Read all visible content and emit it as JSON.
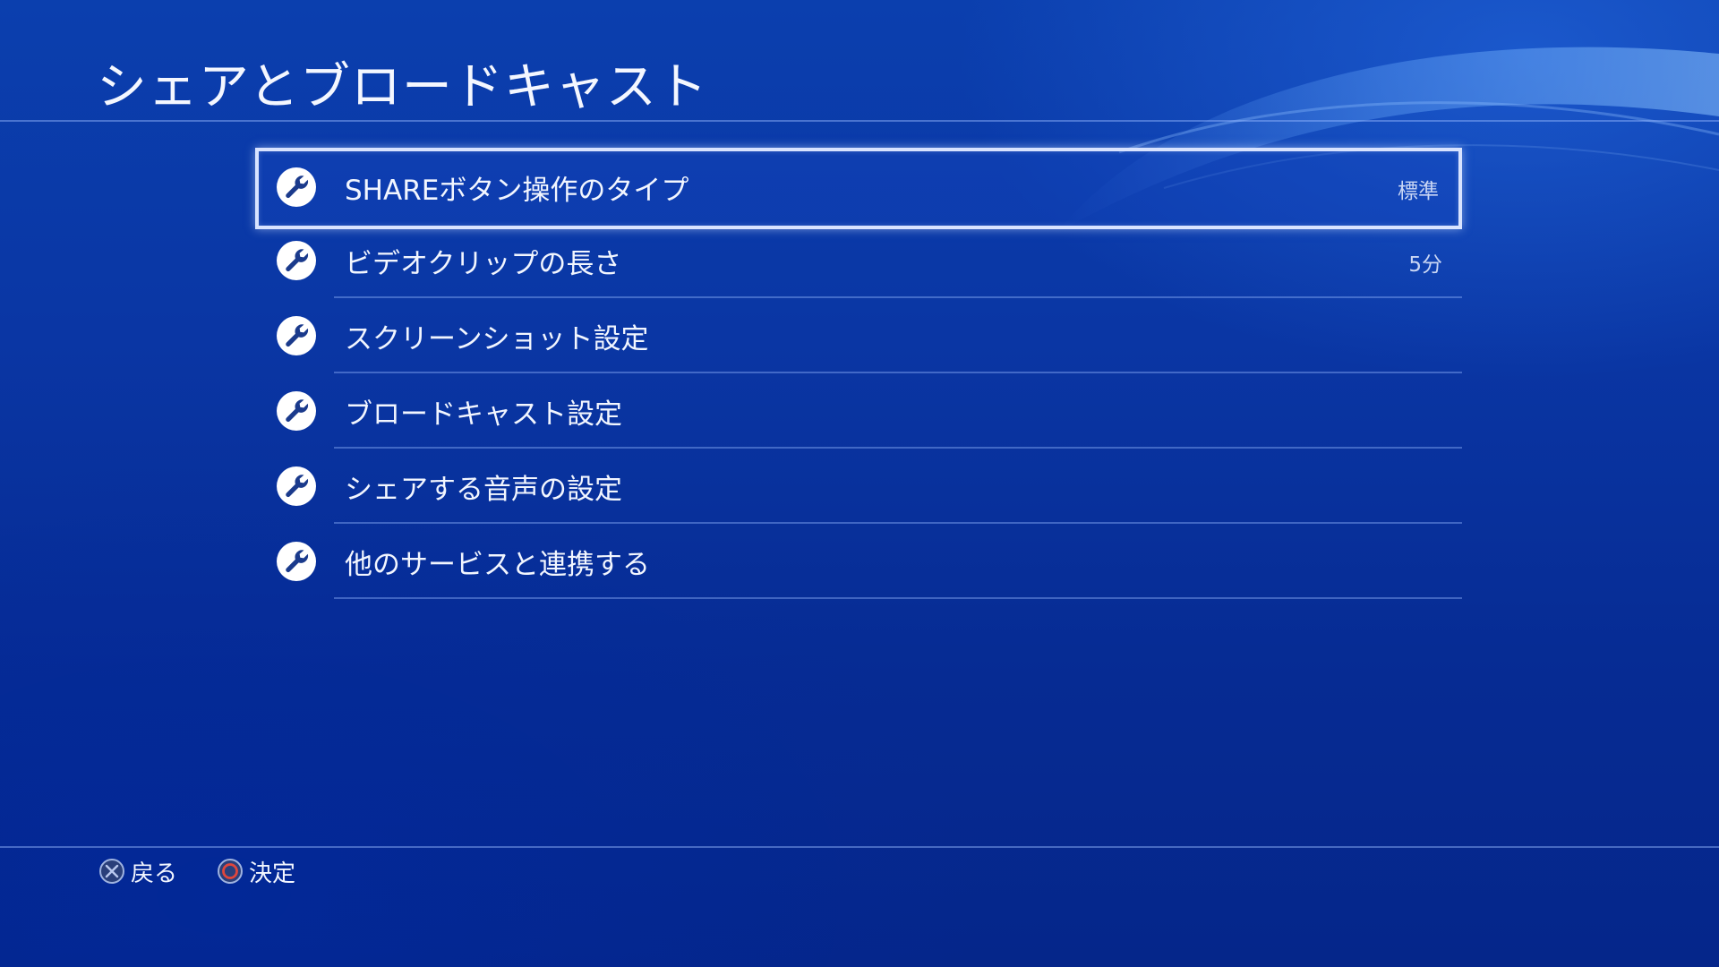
{
  "header": {
    "title": "シェアとブロードキャスト"
  },
  "menu": {
    "items": [
      {
        "label": "SHAREボタン操作のタイプ",
        "value": "標準",
        "icon": "wrench-icon",
        "selected": true
      },
      {
        "label": "ビデオクリップの長さ",
        "value": "5分",
        "icon": "wrench-icon",
        "selected": false
      },
      {
        "label": "スクリーンショット設定",
        "value": "",
        "icon": "wrench-icon",
        "selected": false
      },
      {
        "label": "ブロードキャスト設定",
        "value": "",
        "icon": "wrench-icon",
        "selected": false
      },
      {
        "label": "シェアする音声の設定",
        "value": "",
        "icon": "wrench-icon",
        "selected": false
      },
      {
        "label": "他のサービスと連携する",
        "value": "",
        "icon": "wrench-icon",
        "selected": false
      }
    ]
  },
  "footer": {
    "back": {
      "label": "戻る",
      "icon": "cross-button-icon"
    },
    "enter": {
      "label": "決定",
      "icon": "circle-button-icon"
    }
  },
  "colors": {
    "background_top": "#0b3fae",
    "background_bottom": "#05268a",
    "selection_border": "#d8e3ff",
    "circle_button": "#e0463c"
  }
}
